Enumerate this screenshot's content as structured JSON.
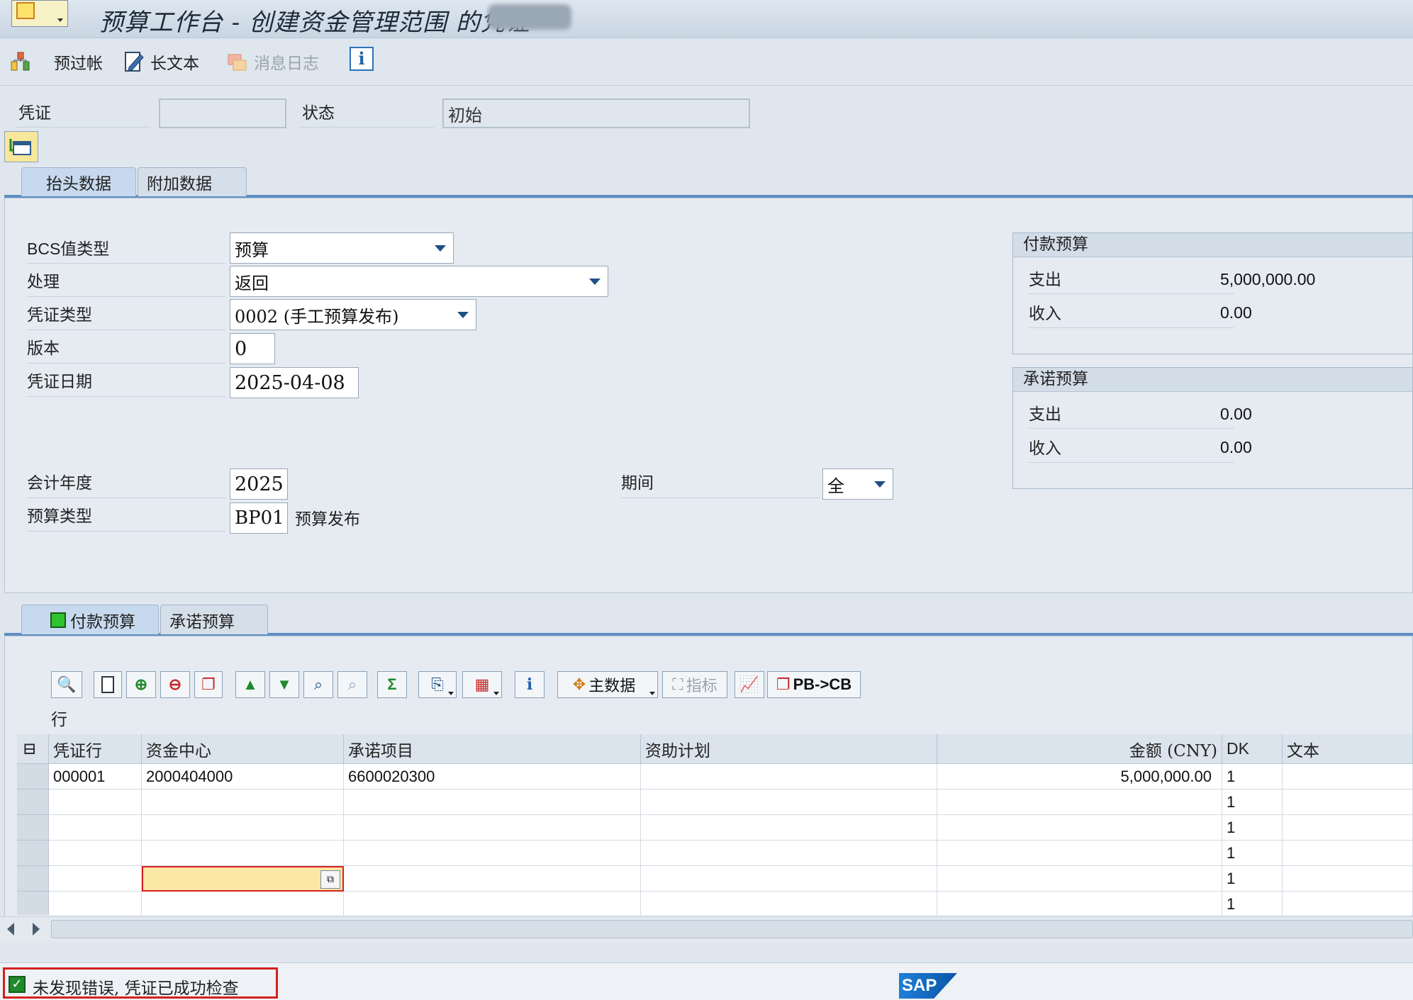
{
  "window": {
    "title": "预算工作台 - 创建资金管理范围 的凭证"
  },
  "toolbar": {
    "prepost": "预过帐",
    "longtext": "长文本",
    "msglog": "消息日志"
  },
  "header": {
    "doc_label": "凭证",
    "doc_value": "",
    "status_label": "状态",
    "status_value": "初始"
  },
  "tabs_top": [
    "抬头数据",
    "附加数据"
  ],
  "form": {
    "bcs_label": "BCS值类型",
    "bcs_value": "预算",
    "process_label": "处理",
    "process_value": "返回",
    "doctype_label": "凭证类型",
    "doctype_value": "0002 (手工预算发布)",
    "version_label": "版本",
    "version_value": "0",
    "docdate_label": "凭证日期",
    "docdate_value": "2025-04-08",
    "fiscal_label": "会计年度",
    "fiscal_value": "2025",
    "period_label": "期间",
    "period_value": "全",
    "budgettype_label": "预算类型",
    "budgettype_value": "BP01",
    "budgettype_desc": "预算发布"
  },
  "payment_budget": {
    "title": "付款预算",
    "exp_label": "支出",
    "exp_value": "5,000,000.00",
    "rev_label": "收入",
    "rev_value": "0.00"
  },
  "commit_budget": {
    "title": "承诺预算",
    "exp_label": "支出",
    "exp_value": "0.00",
    "rev_label": "收入",
    "rev_value": "0.00"
  },
  "tabs_bottom": [
    "付款预算",
    "承诺预算"
  ],
  "grid_toolbar": {
    "masterdata": "主数据",
    "indicator": "指标",
    "pbcb": "PB->CB"
  },
  "grid": {
    "caption": "行",
    "columns": [
      "凭证行",
      "资金中心",
      "承诺项目",
      "资助计划",
      "金额 (CNY)",
      "DK",
      "文本"
    ],
    "rows": [
      [
        "000001",
        "2000404000",
        "6600020300",
        "",
        "5,000,000.00",
        "1",
        ""
      ],
      [
        "",
        "",
        "",
        "",
        "",
        "1",
        ""
      ],
      [
        "",
        "",
        "",
        "",
        "",
        "1",
        ""
      ],
      [
        "",
        "",
        "",
        "",
        "",
        "1",
        ""
      ],
      [
        "",
        "",
        "",
        "",
        "",
        "1",
        ""
      ],
      [
        "",
        "",
        "",
        "",
        "",
        "1",
        ""
      ]
    ]
  },
  "status_bar": {
    "message": "未发现错误, 凭证已成功检查",
    "brand": "SAP"
  },
  "colors": {
    "accent": "#5f8ec4",
    "status_ok": "#1f8a2b",
    "focus_border": "#d62020",
    "focus_fill": "#fbe8a6"
  }
}
